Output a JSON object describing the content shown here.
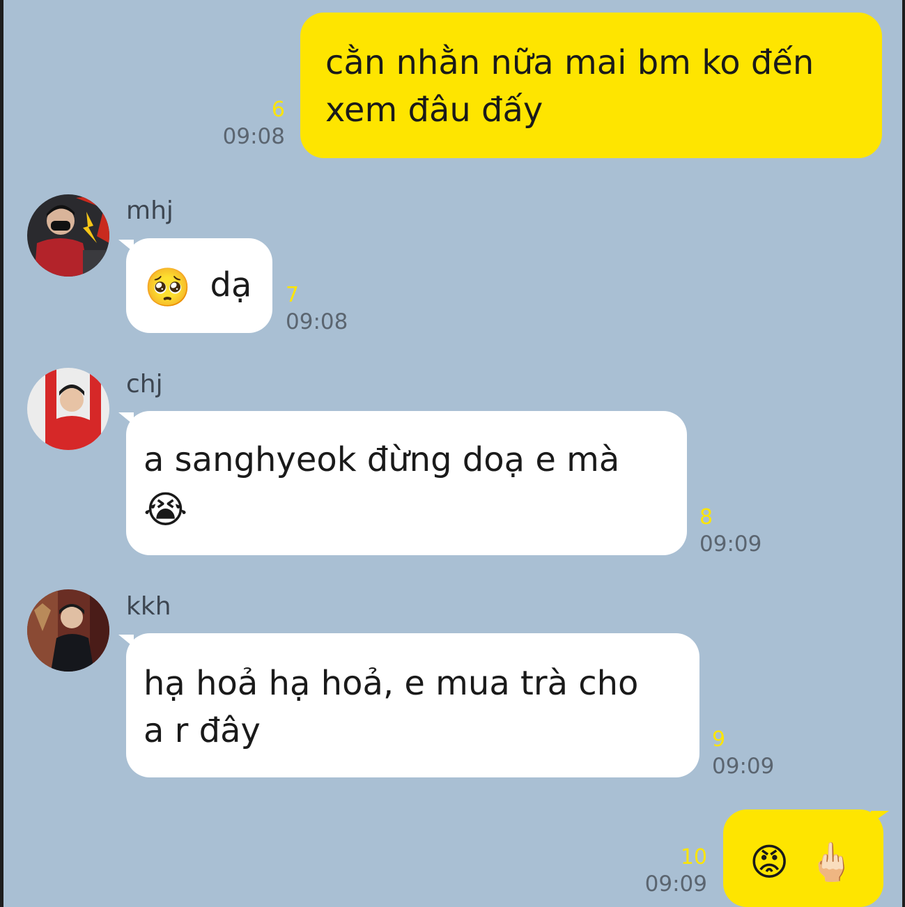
{
  "messages": [
    {
      "sender": "me",
      "text_lines": [
        "cằn nhằn nữa mai bm ko đến",
        "xem đâu đấy"
      ],
      "unread": "6",
      "time": "09:08"
    },
    {
      "sender": "mhj",
      "emoji": "🥺",
      "text": "dạ",
      "unread": "7",
      "time": "09:08"
    },
    {
      "sender": "chj",
      "text_lines": [
        "a sanghyeok đừng doạ e mà"
      ],
      "emoji": "😭",
      "unread": "8",
      "time": "09:09"
    },
    {
      "sender": "kkh",
      "text_lines": [
        "hạ hoả hạ hoả, e mua trà cho",
        "a r đây"
      ],
      "unread": "9",
      "time": "09:09"
    },
    {
      "sender": "me",
      "emoji": "😡",
      "emoji2": "🖕🏻",
      "unread": "10",
      "time": "09:09"
    }
  ],
  "colors": {
    "background": "#a9bfd3",
    "my_bubble": "#fee500",
    "their_bubble": "#ffffff",
    "unread_count": "#fee500"
  }
}
